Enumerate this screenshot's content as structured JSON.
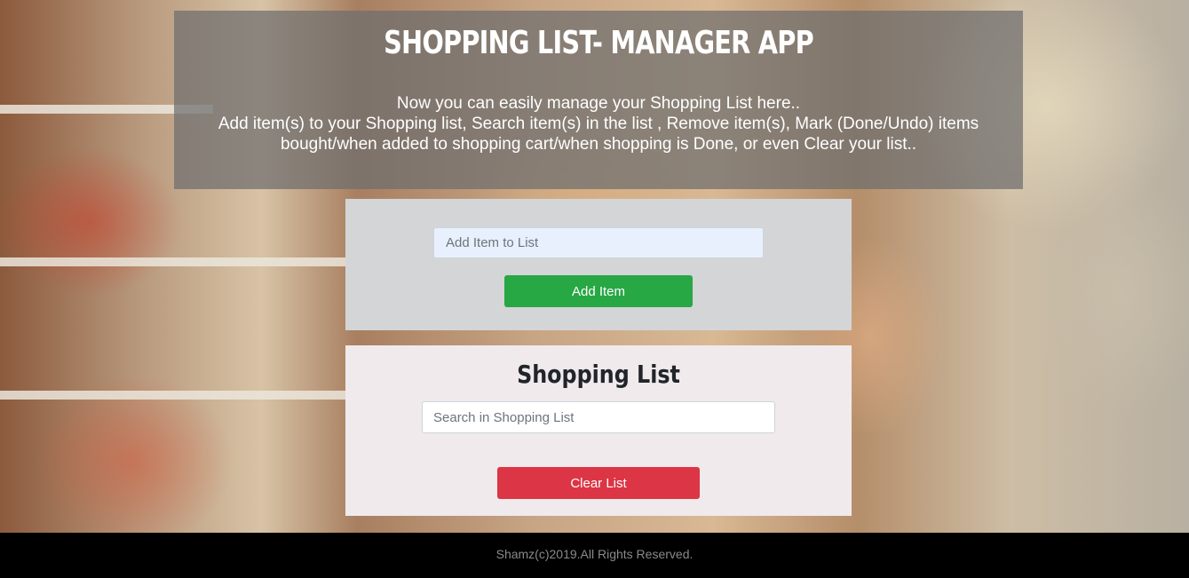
{
  "header": {
    "title": "SHOPPING LIST- MANAGER APP",
    "intro_line1": "Now you can easily manage your Shopping List here..",
    "intro_line2": "Add item(s) to your Shopping list, Search item(s) in the list , Remove item(s), Mark (Done/Undo) items",
    "intro_line3": "bought/when added to shopping cart/when shopping is Done, or even Clear your list.."
  },
  "add_form": {
    "placeholder": "Add Item to List",
    "value": "",
    "button_label": "Add Item"
  },
  "list": {
    "title": "Shopping List",
    "search_placeholder": "Search in Shopping List",
    "search_value": "",
    "items": [],
    "clear_label": "Clear List"
  },
  "footer": {
    "text": "Shamz(c)2019.All Rights Reserved."
  },
  "colors": {
    "add_button": "#28a745",
    "clear_button": "#dc3545",
    "footer_bg": "#000000"
  }
}
